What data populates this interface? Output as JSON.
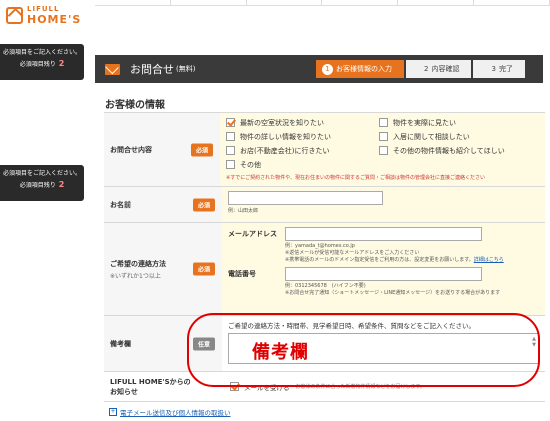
{
  "brand": {
    "small": "LIFULL",
    "big": "HOME'S"
  },
  "side_badges": [
    {
      "line1": "必須項目をご記入ください。",
      "line2": "必須項目残り",
      "count": "2"
    },
    {
      "line1": "必須項目をご記入ください。",
      "line2": "必須項目残り",
      "count": "2"
    }
  ],
  "form_header": {
    "title": "お問合せ",
    "title_sub": "(無料)",
    "steps": [
      {
        "num": "1",
        "label": "お客様情報の入力"
      },
      {
        "num": "2",
        "label": "内容確認"
      },
      {
        "num": "3",
        "label": "完了"
      }
    ]
  },
  "section_title": "お客様の情報",
  "badges": {
    "required": "必須",
    "optional": "任意"
  },
  "inquiry": {
    "label": "お問合せ内容",
    "options": [
      {
        "label": "最新の空室状況を知りたい",
        "checked": true
      },
      {
        "label": "物件を実際に見たい",
        "checked": false
      },
      {
        "label": "物件の詳しい情報を知りたい",
        "checked": false
      },
      {
        "label": "入居に関して相談したい",
        "checked": false
      },
      {
        "label": "お店(不動産会社)に行きたい",
        "checked": false
      },
      {
        "label": "その他の物件情報も紹介してほしい",
        "checked": false
      },
      {
        "label": "その他",
        "checked": false
      }
    ],
    "warning": "※すでにご契約された物件や、現在お住まいの物件に関するご質問・ご相談は物件の管理会社に直接ご連絡ください"
  },
  "name": {
    "label": "お名前",
    "example": "例：山田太郎"
  },
  "contact": {
    "label": "ご希望の連絡方法",
    "note": "※いずれか1つ以上",
    "email_label": "メールアドレス",
    "email_example": "例：yamada_t@homes.co.jp",
    "email_note1": "※返信メールが受信可能なメールアドレスをご入力ください",
    "email_note2": "※携帯電話のメールのドメイン指定受信をご利用の方は、設定変更をお願いします。",
    "email_link": "詳細はこちら",
    "phone_label": "電話番号",
    "phone_example": "例：0312345678　(ハイフン不要)",
    "phone_note": "※お問合せ完了通知（ショートメッセージ・LINE通知メッセージ）をお送りする場合があります"
  },
  "remarks": {
    "label": "備考欄",
    "prompt": "ご希望の連絡方法・時間帯、見学希望日時、希望条件、質問などをご記入ください。",
    "overlay": "備考欄"
  },
  "newsletter": {
    "label_line1": "LIFULL HOME'Sからの",
    "label_line2": "お知らせ",
    "checkbox_label": "メールを受ける",
    "small": "お客様の条件に合った新着物件情報などをお届けします。"
  },
  "footer_link": "電子メール送信及び個人情報の取扱い"
}
